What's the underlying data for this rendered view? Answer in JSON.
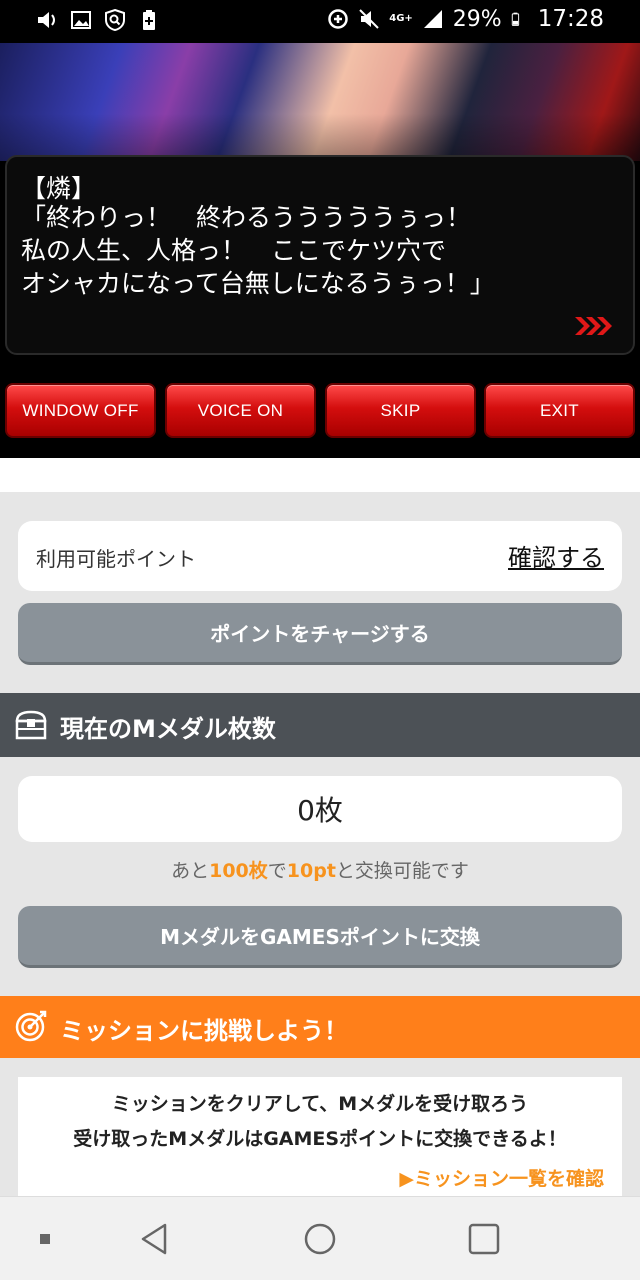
{
  "status_bar": {
    "battery": "29%",
    "time": "17:28",
    "network": "4G+",
    "left_icons": [
      "volume-icon",
      "image-icon",
      "shield-icon",
      "battery-plus-icon"
    ],
    "right_icons": [
      "data-saver-icon",
      "mute-icon",
      "signal-icon",
      "battery-icon"
    ]
  },
  "game": {
    "speaker": "【燐】",
    "dialog": "「終わりっ！　終わるうううううぅっ！\n私の人生、人格っ！　ここでケツ穴で\nオシャカになって台無しになるうぅっ！」",
    "buttons": [
      "WINDOW OFF",
      "VOICE ON",
      "SKIP",
      "EXIT"
    ],
    "accent": "#d40e0e"
  },
  "points": {
    "label": "利用可能ポイント",
    "confirm_link": "確認する",
    "charge_button": "ポイントをチャージする"
  },
  "medal": {
    "title": "現在のMメダル枚数",
    "count": "0枚",
    "note_prefix": "あと",
    "note_medals": "100枚",
    "note_mid": "で",
    "note_points": "10pt",
    "note_suffix": "と交換可能です",
    "exchange_button": "MメダルをGAMESポイントに交換"
  },
  "mission": {
    "title": "ミッションに挑戦しよう！",
    "line1": "ミッションをクリアして、Mメダルを受け取ろう",
    "line2": "受け取ったMメダルはGAMESポイントに交換できるよ！",
    "link": "▶ミッション一覧を確認",
    "accent": "#ff7f1a"
  },
  "nav": {
    "items": [
      "square-dot-icon",
      "back-icon",
      "home-icon",
      "recents-icon"
    ]
  }
}
